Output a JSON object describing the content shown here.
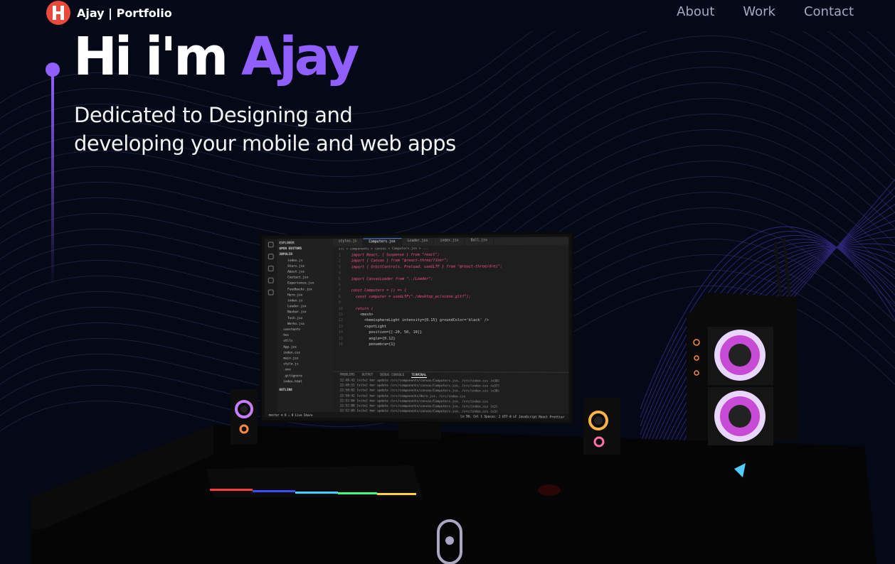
{
  "nav": {
    "logo_letter": "H",
    "logo_text": "Ajay | Portfolio",
    "links": [
      "About",
      "Work",
      "Contact"
    ]
  },
  "hero": {
    "title_prefix": "Hi i'm",
    "title_name": "Ajay",
    "subtitle_line1": "Dedicated to Designing and",
    "subtitle_line2": "developing your mobile and web apps"
  },
  "colors": {
    "background": "#050816",
    "accent": "#915eff",
    "nav_link": "#aaa6c3",
    "logo": "#e84b3c"
  },
  "monitor": {
    "explorer_title": "EXPLORER",
    "open_editors": "OPEN EDITORS",
    "project": "3DFOLIO",
    "files": [
      "index.js",
      "Stars.jsx",
      "About.jsx",
      "Contact.jsx",
      "Experience.jsx",
      "Feedbacks.jsx",
      "Hero.jsx",
      "index.js",
      "Loader.jsx",
      "Navbar.jsx",
      "Tech.jsx",
      "Works.jsx"
    ],
    "folders": [
      "constants",
      "hoc",
      "utils"
    ],
    "root_files": [
      "App.jsx",
      "index.css",
      "main.jsx",
      "style.js",
      ".env",
      ".gitignore",
      "index.html"
    ],
    "outline": "OUTLINE",
    "tabs": [
      "styles.js",
      "Computers.jsx",
      "Loader.jsx",
      "index.jsx",
      "Ball.jsx"
    ],
    "breadcrumb": "src > components > canvas > Computers.jsx > ...",
    "code_lines": [
      "import React, { Suspense } from \"react\";",
      "import { Canvas } from \"@react-three/fiber\";",
      "import { OrbitControls, Preload, useGLTF } from \"@react-three/drei\";",
      "",
      "import CanvasLoader from \"../Loader\";",
      "",
      "const Computers = () => {",
      "  const computer = useGLTF(\"./desktop_pc/scene.gltf\");",
      "",
      "  return (",
      "    <mesh>",
      "      <hemisphereLight intensity={0.15} groundColor='black' />",
      "      <spotLight",
      "        position={[-20, 50, 10]}",
      "        angle={0.12}",
      "        penumbra={1}"
    ],
    "panel_tabs": [
      "PROBLEMS",
      "OUTPUT",
      "DEBUG CONSOLE",
      "TERMINAL"
    ],
    "terminal_lines": [
      "22:48:43 [vite] hmr update /src/components/canvas/Computers.jsx, /src/index.css (x30)",
      "22:48:51 [vite] hmr update /src/components/canvas/Computers.jsx, /src/index.css (x37)",
      "22:50:02 [vite] hmr update /src/components/canvas/Computers.jsx, /src/index.css (x38)",
      "22:50:42 [vite] hmr update /src/components/Hero.jsx, /src/index.css",
      "22:52:04 [vite] hmr update /src/components/canvas/Computers.jsx, /src/index.css",
      "22:52:08 [vite] hmr update /src/components/canvas/Computers.jsx, /src/index.css (x2)",
      "22:52:09 [vite] hmr update /src/components/canvas/Computers.jsx, /src/index.css (x3)"
    ],
    "status_left": "master  ⊗ 0 ⚠ 0  Live Share",
    "status_right": "Ln 50, Col 1  Spaces: 2  UTF-8  LF  JavaScript React  Prettier"
  }
}
